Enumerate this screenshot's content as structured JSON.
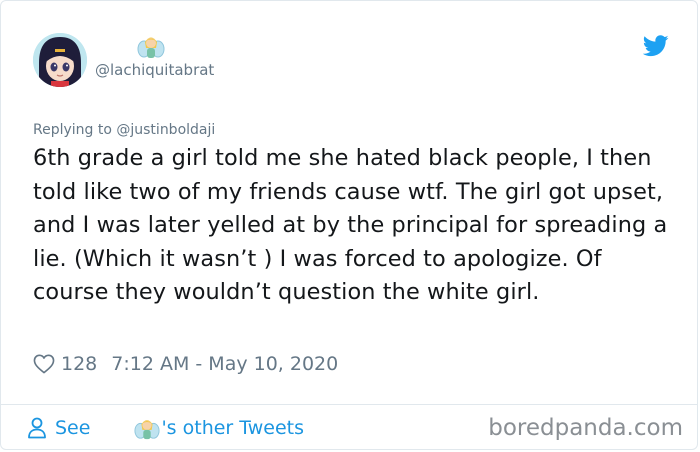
{
  "user": {
    "handle": "@lachiquitabrat",
    "name_emoji": "fairy-emoji"
  },
  "tweet": {
    "reply_label": "Replying to @justinboldaji",
    "text": "6th grade a girl told me she hated black people, I then told like two of my friends cause wtf. The girl got upset, and I was later yelled at by the principal for spreading a lie. (Which it wasn’t ) I was forced to apologize. Of course they wouldn’t question the white girl.",
    "likes": "128",
    "timestamp": "7:12 AM - May 10, 2020"
  },
  "footer": {
    "see_label": "See",
    "other_tweets_label": "'s other Tweets",
    "watermark": "boredpanda.com"
  },
  "colors": {
    "link": "#1b95e0",
    "twitter": "#1da1f2",
    "muted": "#657786",
    "text": "#14171a"
  },
  "icons": [
    "avatar",
    "fairy-emoji",
    "twitter-bird-icon",
    "heart-icon",
    "person-icon"
  ]
}
